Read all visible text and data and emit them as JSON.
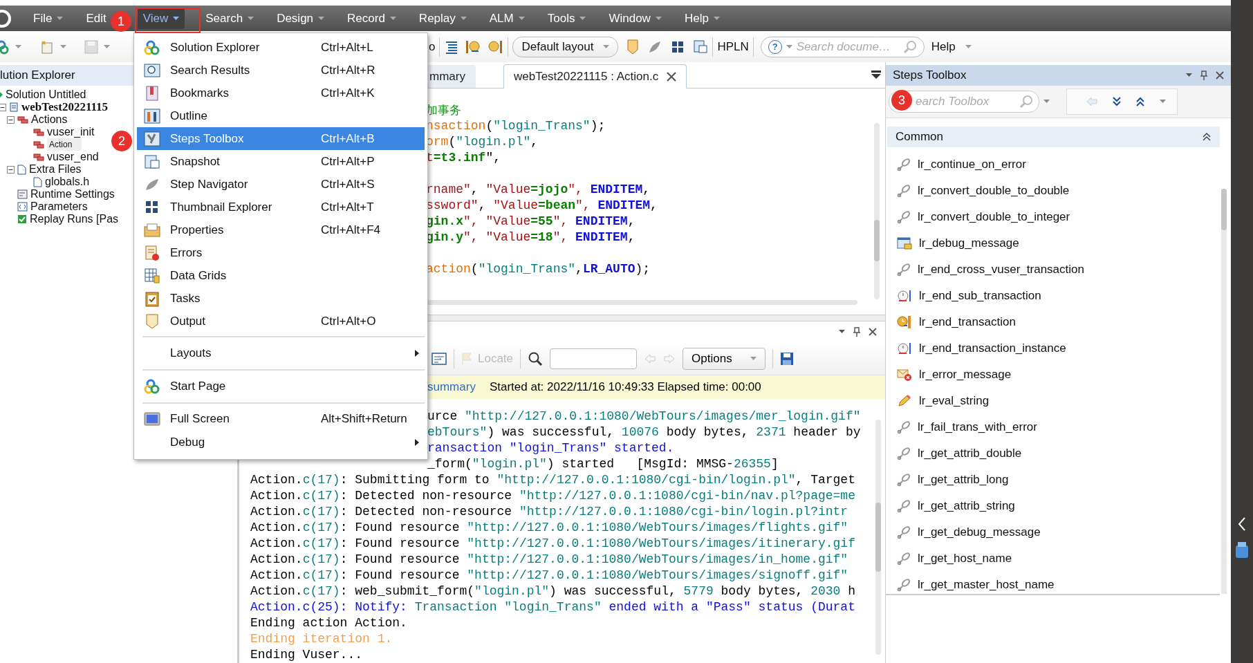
{
  "menubar": {
    "items": [
      {
        "label": "File",
        "selected": false,
        "caret": true
      },
      {
        "label": "Edit",
        "selected": false,
        "caret": false
      },
      {
        "label": "View",
        "selected": true,
        "caret": true
      },
      {
        "label": "Search",
        "selected": false,
        "caret": true
      },
      {
        "label": "Design",
        "selected": false,
        "caret": true
      },
      {
        "label": "Record",
        "selected": false,
        "caret": true
      },
      {
        "label": "Replay",
        "selected": false,
        "caret": true
      },
      {
        "label": "ALM",
        "selected": false,
        "caret": true
      },
      {
        "label": "Tools",
        "selected": false,
        "caret": true
      },
      {
        "label": "Window",
        "selected": false,
        "caret": true
      },
      {
        "label": "Help",
        "selected": false,
        "caret": true
      }
    ]
  },
  "toolbar": {
    "cut_text": "o",
    "layout_dropdown": "Default layout",
    "hpln": "HPLN",
    "search": {
      "help_glyph": "?",
      "placeholder": "Search docume…"
    },
    "help": "Help"
  },
  "solution_explorer": {
    "title": "lution Explorer",
    "tree": [
      {
        "label": "Solution Untitled",
        "selected": false
      },
      {
        "label": "webTest20221115",
        "expanded": true,
        "selected": false,
        "children": [
          {
            "label": "Actions",
            "expanded": true,
            "selected": false,
            "children": [
              {
                "label": "vuser_init",
                "selected": false
              },
              {
                "label": "Action",
                "selected": true
              },
              {
                "label": "vuser_end",
                "selected": false
              }
            ]
          },
          {
            "label": "Extra Files",
            "expanded": true,
            "selected": false,
            "children": [
              {
                "label": "globals.h",
                "selected": false
              }
            ]
          },
          {
            "label": "Runtime Settings",
            "selected": false
          },
          {
            "label": "Parameters",
            "selected": false
          },
          {
            "label": "Replay Runs [Pas",
            "selected": false
          }
        ]
      }
    ]
  },
  "editor": {
    "tabs": [
      {
        "label": "mmary",
        "selected": false
      },
      {
        "label": "webTest20221115 : Action.c",
        "selected": true
      }
    ],
    "lines": [
      {
        "kind": "code",
        "parts": [
          {
            "text": "加事务",
            "kind": "comment"
          }
        ]
      },
      {
        "kind": "code",
        "parts": [
          {
            "text": "nsaction",
            "kind": "func"
          },
          {
            "text": "(",
            "kind": "plain"
          },
          {
            "text": "\"login_Trans\"",
            "kind": "string"
          },
          {
            "text": ");",
            "kind": "plain"
          }
        ]
      },
      {
        "kind": "code",
        "parts": [
          {
            "text": "orm",
            "kind": "func"
          },
          {
            "text": "(",
            "kind": "plain"
          },
          {
            "text": "\"login.pl\"",
            "kind": "string"
          },
          {
            "text": ",",
            "kind": "plain"
          }
        ]
      },
      {
        "kind": "code",
        "parts": [
          {
            "text": "t",
            "kind": "attr"
          },
          {
            "text": "=t3.inf",
            "kind": "value"
          },
          {
            "text": "\",",
            "kind": "plain"
          }
        ]
      },
      {
        "kind": "blank"
      },
      {
        "kind": "code",
        "parts": [
          {
            "text": "rname\"",
            "kind": "attr"
          },
          {
            "text": ", ",
            "kind": "plain"
          },
          {
            "text": "\"Value",
            "kind": "attr"
          },
          {
            "text": "=jojo",
            "kind": "value"
          },
          {
            "text": "\", ",
            "kind": "attr"
          },
          {
            "text": "ENDITEM",
            "kind": "keyword"
          },
          {
            "text": ",",
            "kind": "plain"
          }
        ]
      },
      {
        "kind": "code",
        "parts": [
          {
            "text": "ssword\"",
            "kind": "attr"
          },
          {
            "text": ", ",
            "kind": "plain"
          },
          {
            "text": "\"Value",
            "kind": "attr"
          },
          {
            "text": "=bean",
            "kind": "value"
          },
          {
            "text": "\", ",
            "kind": "attr"
          },
          {
            "text": "ENDITEM",
            "kind": "keyword"
          },
          {
            "text": ",",
            "kind": "plain"
          }
        ]
      },
      {
        "kind": "code",
        "parts": [
          {
            "text": "gin.x",
            "kind": "value"
          },
          {
            "text": "\", ",
            "kind": "attr"
          },
          {
            "text": "\"Value",
            "kind": "attr"
          },
          {
            "text": "=55",
            "kind": "value"
          },
          {
            "text": "\", ",
            "kind": "attr"
          },
          {
            "text": "ENDITEM",
            "kind": "keyword"
          },
          {
            "text": ",",
            "kind": "plain"
          }
        ]
      },
      {
        "kind": "code",
        "parts": [
          {
            "text": "gin.y",
            "kind": "value"
          },
          {
            "text": "\", ",
            "kind": "attr"
          },
          {
            "text": "\"Value",
            "kind": "attr"
          },
          {
            "text": "=18",
            "kind": "value"
          },
          {
            "text": "\", ",
            "kind": "attr"
          },
          {
            "text": "ENDITEM",
            "kind": "keyword"
          },
          {
            "text": ",",
            "kind": "plain"
          }
        ]
      },
      {
        "kind": "blank"
      },
      {
        "kind": "code",
        "parts": [
          {
            "text": "action",
            "kind": "func"
          },
          {
            "text": "(",
            "kind": "plain"
          },
          {
            "text": "\"login_Trans\"",
            "kind": "string"
          },
          {
            "text": ",",
            "kind": "plain"
          },
          {
            "text": "LR_AUTO",
            "kind": "keyword"
          },
          {
            "text": ");",
            "kind": "plain"
          }
        ]
      }
    ]
  },
  "output": {
    "toolbar": {
      "locate": "Locate",
      "options": "Options"
    },
    "summary_link": "summary",
    "summary_text": "Started at: 2022/11/16 10:49:33 Elapsed time: 00:00",
    "lines": [
      {
        "kind": "behind_menu",
        "parts": [
          {
            "text": "urce ",
            "kind": "plain"
          },
          {
            "text": "\"http://127.0.0.1:1080/WebTours/images/mer_login.gif\"",
            "kind": "url"
          }
        ]
      },
      {
        "kind": "behind_menu",
        "parts": [
          {
            "text": "ebTours\"",
            "kind": "url"
          },
          {
            "text": ") was successful, ",
            "kind": "plain"
          },
          {
            "text": "10076",
            "kind": "num"
          },
          {
            "text": " body bytes, ",
            "kind": "plain"
          },
          {
            "text": "2371",
            "kind": "num"
          },
          {
            "text": " header by",
            "kind": "plain"
          }
        ]
      },
      {
        "kind": "behind_menu",
        "parts": [
          {
            "text": "ransaction \"login_Trans\" started.",
            "kind": "notify"
          }
        ]
      },
      {
        "kind": "behind_menu",
        "parts": [
          {
            "text": "_form(",
            "kind": "plain"
          },
          {
            "text": "\"login.pl\"",
            "kind": "url"
          },
          {
            "text": ") started   [MsgId: MMSG-",
            "kind": "plain"
          },
          {
            "text": "26355",
            "kind": "num"
          },
          {
            "text": "]",
            "kind": "plain"
          }
        ]
      },
      {
        "kind": "full",
        "parts": [
          {
            "text": "Action.",
            "kind": "plain"
          },
          {
            "text": "c(17)",
            "kind": "num"
          },
          {
            "text": ": Submitting form to ",
            "kind": "plain"
          },
          {
            "text": "\"http://127.0.0.1:1080/cgi-bin/login.pl\"",
            "kind": "url"
          },
          {
            "text": ", Target",
            "kind": "plain"
          }
        ]
      },
      {
        "kind": "full",
        "parts": [
          {
            "text": "Action.",
            "kind": "plain"
          },
          {
            "text": "c(17)",
            "kind": "num"
          },
          {
            "text": ": Detected non-resource ",
            "kind": "plain"
          },
          {
            "text": "\"http://127.0.0.1:1080/cgi-bin/nav.pl?page=me",
            "kind": "url"
          }
        ]
      },
      {
        "kind": "full",
        "parts": [
          {
            "text": "Action.",
            "kind": "plain"
          },
          {
            "text": "c(17)",
            "kind": "num"
          },
          {
            "text": ": Detected non-resource ",
            "kind": "plain"
          },
          {
            "text": "\"http://127.0.0.1:1080/cgi-bin/login.pl?intr",
            "kind": "url"
          }
        ]
      },
      {
        "kind": "full",
        "parts": [
          {
            "text": "Action.",
            "kind": "plain"
          },
          {
            "text": "c(17)",
            "kind": "num"
          },
          {
            "text": ": Found resource ",
            "kind": "plain"
          },
          {
            "text": "\"http://127.0.0.1:1080/WebTours/images/flights.gif\"",
            "kind": "url"
          }
        ]
      },
      {
        "kind": "full",
        "parts": [
          {
            "text": "Action.",
            "kind": "plain"
          },
          {
            "text": "c(17)",
            "kind": "num"
          },
          {
            "text": ": Found resource ",
            "kind": "plain"
          },
          {
            "text": "\"http://127.0.0.1:1080/WebTours/images/itinerary.gif",
            "kind": "url"
          }
        ]
      },
      {
        "kind": "full",
        "parts": [
          {
            "text": "Action.",
            "kind": "plain"
          },
          {
            "text": "c(17)",
            "kind": "num"
          },
          {
            "text": ": Found resource ",
            "kind": "plain"
          },
          {
            "text": "\"http://127.0.0.1:1080/WebTours/images/in_home.gif\"",
            "kind": "url"
          }
        ]
      },
      {
        "kind": "full",
        "parts": [
          {
            "text": "Action.",
            "kind": "plain"
          },
          {
            "text": "c(17)",
            "kind": "num"
          },
          {
            "text": ": Found resource ",
            "kind": "plain"
          },
          {
            "text": "\"http://127.0.0.1:1080/WebTours/images/signoff.gif\"",
            "kind": "url"
          }
        ]
      },
      {
        "kind": "full",
        "parts": [
          {
            "text": "Action.",
            "kind": "plain"
          },
          {
            "text": "c(17)",
            "kind": "num"
          },
          {
            "text": ": web_submit_form(",
            "kind": "plain"
          },
          {
            "text": "\"login.pl\"",
            "kind": "url"
          },
          {
            "text": ") was successful, ",
            "kind": "plain"
          },
          {
            "text": "5779",
            "kind": "num"
          },
          {
            "text": " body bytes, ",
            "kind": "plain"
          },
          {
            "text": "2030",
            "kind": "num"
          },
          {
            "text": " h",
            "kind": "plain"
          }
        ]
      },
      {
        "kind": "full",
        "parts": [
          {
            "text": "Action.c(25): Notify: ",
            "kind": "notify"
          },
          {
            "text": "Transaction \"login_Trans\"",
            "kind": "url"
          },
          {
            "text": " ended with a \"Pass\" status (Durat",
            "kind": "notify"
          }
        ]
      },
      {
        "kind": "full",
        "parts": [
          {
            "text": "Ending action Action.",
            "kind": "plain"
          }
        ]
      },
      {
        "kind": "full",
        "parts": [
          {
            "text": "Ending iteration 1.",
            "kind": "warn"
          }
        ]
      },
      {
        "kind": "full",
        "parts": [
          {
            "text": "Ending Vuser...",
            "kind": "plain"
          }
        ]
      }
    ]
  },
  "steps_toolbox": {
    "title": "Steps Toolbox",
    "search": {
      "placeholder": "earch Toolbox"
    },
    "group": "Common",
    "expanded": true,
    "items": [
      "lr_continue_on_error",
      "lr_convert_double_to_double",
      "lr_convert_double_to_integer",
      "lr_debug_message",
      "lr_end_cross_vuser_transaction",
      "lr_end_sub_transaction",
      "lr_end_transaction",
      "lr_end_transaction_instance",
      "lr_error_message",
      "lr_eval_string",
      "lr_fail_trans_with_error",
      "lr_get_attrib_double",
      "lr_get_attrib_long",
      "lr_get_attrib_string",
      "lr_get_debug_message",
      "lr_get_host_name",
      "lr_get_master_host_name"
    ]
  },
  "view_menu": {
    "groups": [
      [
        {
          "label": "Solution Explorer",
          "shortcut": "Ctrl+Alt+L",
          "selected": false
        },
        {
          "label": "Search Results",
          "shortcut": "Ctrl+Alt+R",
          "selected": false
        },
        {
          "label": "Bookmarks",
          "shortcut": "Ctrl+Alt+K",
          "selected": false
        },
        {
          "label": "Outline",
          "selected": false
        },
        {
          "label": "Steps Toolbox",
          "shortcut": "Ctrl+Alt+B",
          "selected": true
        },
        {
          "label": "Snapshot",
          "shortcut": "Ctrl+Alt+P",
          "selected": false
        },
        {
          "label": "Step Navigator",
          "shortcut": "Ctrl+Alt+S",
          "selected": false
        },
        {
          "label": "Thumbnail Explorer",
          "shortcut": "Ctrl+Alt+T",
          "selected": false
        },
        {
          "label": "Properties",
          "shortcut": "Ctrl+Alt+F4",
          "selected": false
        },
        {
          "label": "Errors",
          "selected": false
        },
        {
          "label": "Data Grids",
          "selected": false
        },
        {
          "label": "Tasks",
          "selected": false
        },
        {
          "label": "Output",
          "shortcut": "Ctrl+Alt+O",
          "selected": false
        }
      ],
      [
        {
          "label": "Layouts",
          "submenu": true,
          "selected": false
        }
      ],
      [
        {
          "label": "Start Page",
          "selected": false
        }
      ],
      [
        {
          "label": "Full Screen",
          "shortcut": "Alt+Shift+Return",
          "selected": false
        },
        {
          "label": "Debug",
          "submenu": true,
          "selected": false
        }
      ]
    ]
  },
  "annotations": [
    {
      "text": "1"
    },
    {
      "text": "2"
    },
    {
      "text": "3"
    }
  ]
}
